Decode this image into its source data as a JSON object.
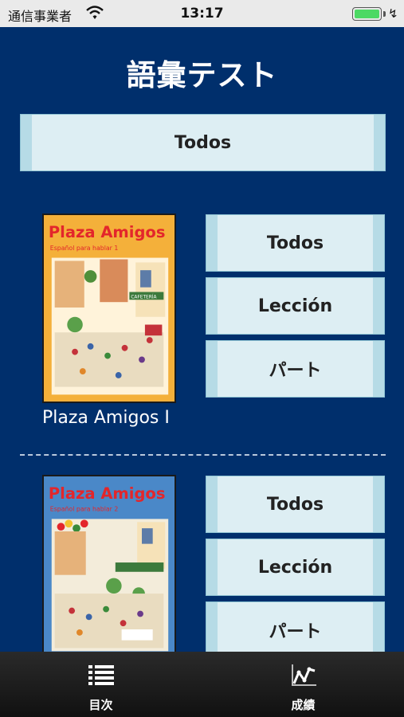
{
  "status_bar": {
    "carrier": "通信事業者",
    "time": "13:17",
    "wifi_icon": "wifi-icon",
    "battery_icon": "battery-icon",
    "charging_icon": "charging-bolt-icon"
  },
  "title": "語彙テスト",
  "all_button": {
    "label": "Todos"
  },
  "books": [
    {
      "cover": {
        "heading": "Plaza Amigos",
        "subtitle": "Español para hablar 1",
        "sign": "CAFETERÍA"
      },
      "name": "Plaza Amigos I",
      "buttons": {
        "all": "Todos",
        "lesson": "Lección",
        "part": "パート"
      }
    },
    {
      "cover": {
        "heading": "Plaza Amigos",
        "subtitle": "Español para hablar 2"
      },
      "buttons": {
        "all": "Todos",
        "lesson": "Lección",
        "part": "パート"
      }
    }
  ],
  "tab_bar": {
    "items": [
      {
        "label": "目次",
        "icon": "list-icon"
      },
      {
        "label": "成績",
        "icon": "chart-icon"
      }
    ]
  },
  "colors": {
    "background": "#002f6c",
    "button_fill": "#ddeef3",
    "button_edge": "#b6dbe6",
    "cover1": "#f4b03a",
    "cover2": "#4a88c8"
  }
}
